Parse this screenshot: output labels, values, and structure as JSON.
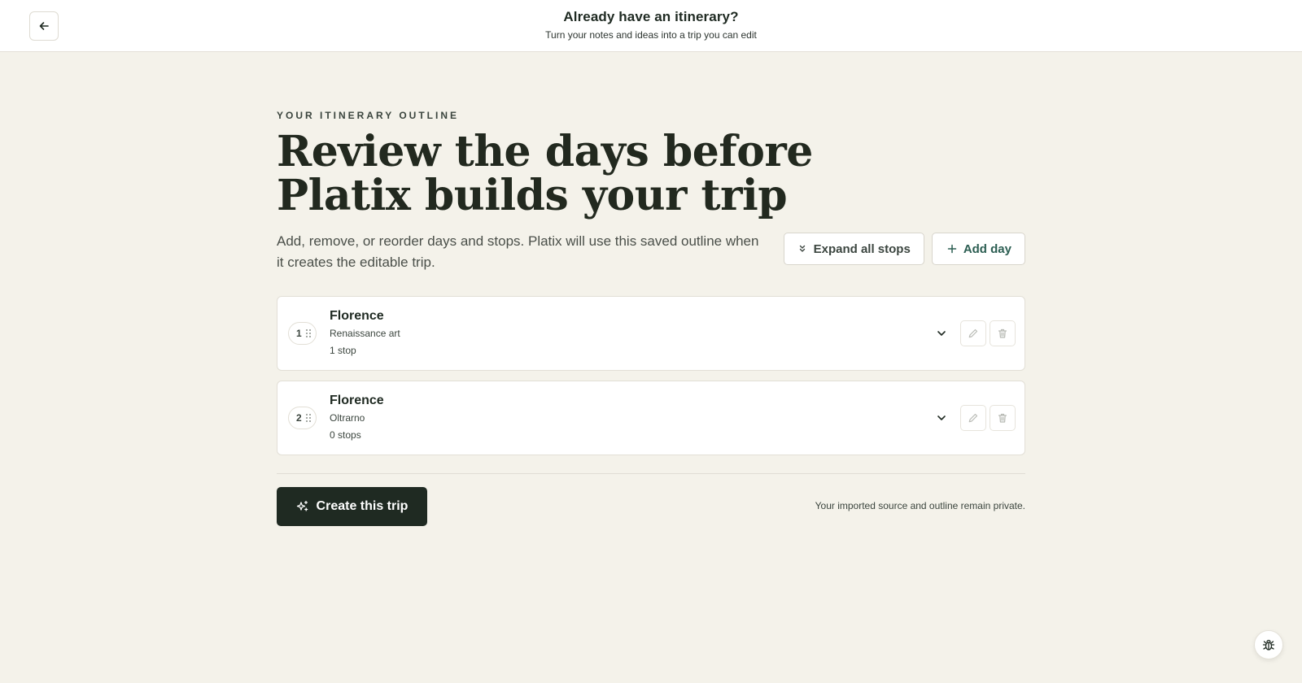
{
  "header": {
    "back_icon": "arrow-left-icon",
    "title": "Already have an itinerary?",
    "subtitle": "Turn your notes and ideas into a trip you can edit"
  },
  "main": {
    "eyebrow": "YOUR ITINERARY OUTLINE",
    "headline_line1": "Review the days before",
    "headline_line2": "Platix builds your trip",
    "description": "Add, remove, or reorder days and stops. Platix will use this saved outline when it creates the editable trip.",
    "expand_label": "Expand all stops",
    "expand_icon": "chevrons-down-icon",
    "add_day_label": "Add day",
    "add_day_icon": "plus-icon"
  },
  "days": [
    {
      "number": "1",
      "title": "Florence",
      "theme": "Renaissance art",
      "stops": "1 stop"
    },
    {
      "number": "2",
      "title": "Florence",
      "theme": "Oltrarno",
      "stops": "0 stops"
    }
  ],
  "footer": {
    "create_label": "Create this trip",
    "create_icon": "sparkles-icon",
    "privacy_note": "Your imported source and outline remain private."
  },
  "debug_icon": "bug-icon",
  "colors": {
    "background": "#f4f2ea",
    "primary_dark": "#1f2a22",
    "accent_green": "#2c5e52",
    "card": "#ffffff",
    "border": "#e2dfd6"
  }
}
